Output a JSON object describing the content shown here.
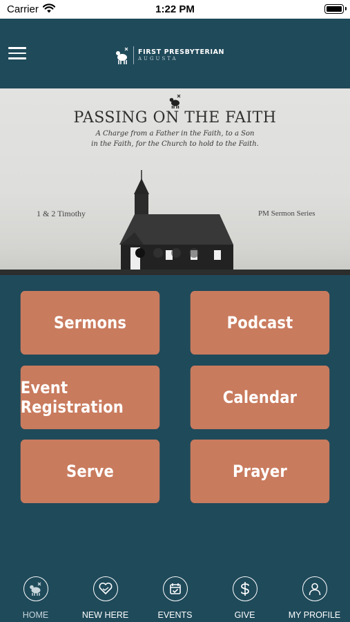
{
  "status_bar": {
    "carrier": "Carrier",
    "time": "1:22 PM"
  },
  "header": {
    "brand_name": "FIRST PRESBYTERIAN",
    "brand_sub": "AUGUSTA"
  },
  "banner": {
    "title": "PASSING ON THE FAITH",
    "tagline_line1": "A Charge from a Father in the Faith, to a Son",
    "tagline_line2": "in the Faith, for the Church to hold to the Faith.",
    "left_label": "1 & 2 Timothy",
    "right_label": "PM Sermon  Series",
    "slide_count": 4,
    "active_slide": 1
  },
  "menu_tiles": [
    {
      "label": "Sermons"
    },
    {
      "label": "Podcast"
    },
    {
      "label": "Event Registration"
    },
    {
      "label": "Calendar"
    },
    {
      "label": "Serve"
    },
    {
      "label": "Prayer"
    }
  ],
  "tabs": [
    {
      "label": "HOME",
      "icon": "lamb-icon"
    },
    {
      "label": "NEW HERE",
      "icon": "heart-hands-icon"
    },
    {
      "label": "EVENTS",
      "icon": "calendar-check-icon"
    },
    {
      "label": "GIVE",
      "icon": "dollar-icon"
    },
    {
      "label": "MY PROFILE",
      "icon": "person-icon"
    }
  ],
  "colors": {
    "background": "#1f4a5a",
    "tile": "#c97b5e",
    "text": "#ffffff"
  }
}
